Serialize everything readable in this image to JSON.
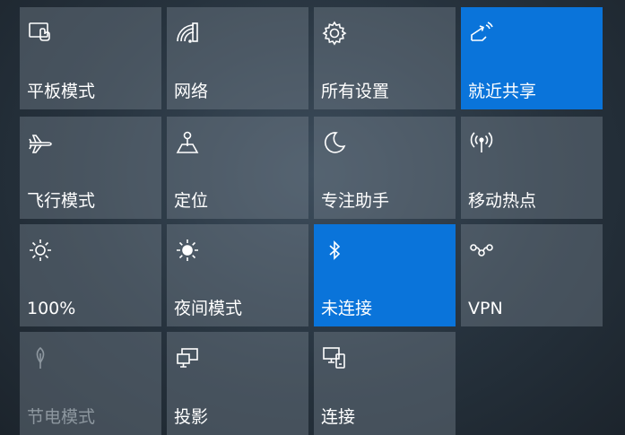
{
  "action_center": {
    "tiles": [
      {
        "label": "平板模式",
        "icon": "tablet-mode-icon",
        "active": false,
        "disabled": false
      },
      {
        "label": "网络",
        "icon": "network-icon",
        "active": false,
        "disabled": false
      },
      {
        "label": "所有设置",
        "icon": "gear-icon",
        "active": false,
        "disabled": false
      },
      {
        "label": "就近共享",
        "icon": "nearby-share-icon",
        "active": true,
        "disabled": false
      },
      {
        "label": "飞行模式",
        "icon": "airplane-icon",
        "active": false,
        "disabled": false
      },
      {
        "label": "定位",
        "icon": "location-icon",
        "active": false,
        "disabled": false
      },
      {
        "label": "专注助手",
        "icon": "moon-icon",
        "active": false,
        "disabled": false
      },
      {
        "label": "移动热点",
        "icon": "hotspot-icon",
        "active": false,
        "disabled": false
      },
      {
        "label": "100%",
        "icon": "brightness-icon",
        "active": false,
        "disabled": false
      },
      {
        "label": "夜间模式",
        "icon": "night-light-icon",
        "active": false,
        "disabled": false
      },
      {
        "label": "未连接",
        "icon": "bluetooth-icon",
        "active": true,
        "disabled": false
      },
      {
        "label": "VPN",
        "icon": "vpn-icon",
        "active": false,
        "disabled": false
      },
      {
        "label": "节电模式",
        "icon": "battery-saver-icon",
        "active": false,
        "disabled": true
      },
      {
        "label": "投影",
        "icon": "project-icon",
        "active": false,
        "disabled": false
      },
      {
        "label": "连接",
        "icon": "connect-icon",
        "active": false,
        "disabled": false
      }
    ],
    "colors": {
      "active": "#0a74da",
      "tile": "#5d6a75",
      "disabled_text": "#8d979f"
    }
  }
}
